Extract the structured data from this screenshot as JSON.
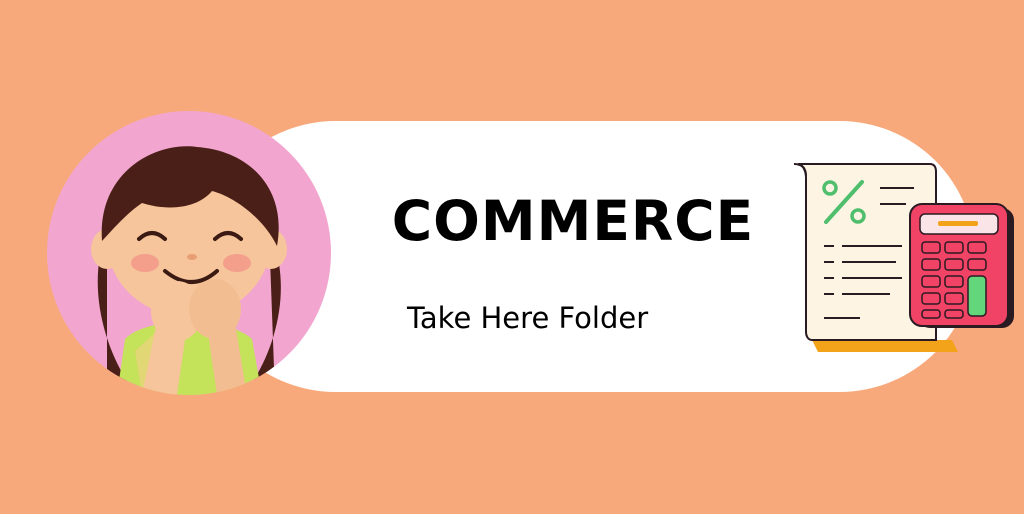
{
  "banner": {
    "title": "COMMERCE",
    "subtitle": "Take Here Folder"
  },
  "icons": {
    "girl": "smiling-girl-illustration",
    "receipt": "percent-receipt-icon",
    "calculator": "calculator-icon"
  },
  "colors": {
    "background": "#f8a97b",
    "pill": "#ffffff",
    "circle": "#f2a6cf",
    "hair": "#4a1f17",
    "skin": "#f6c59b",
    "shirt": "#c4e25a",
    "receipt_paper": "#fdf4e4",
    "receipt_edge": "#f3a31a",
    "percent_green": "#4fbe6d",
    "calculator_body": "#f04365",
    "calculator_dark": "#2a1a22",
    "calculator_screen": "#fbe4e8",
    "calculator_key_green": "#63d67b",
    "screen_bar": "#f3a31a"
  }
}
